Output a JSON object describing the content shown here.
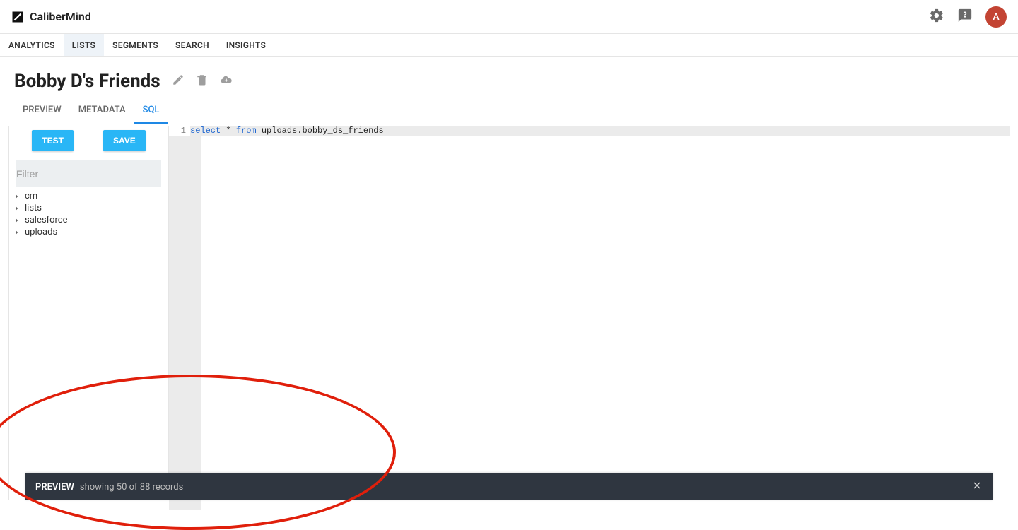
{
  "brand": {
    "name": "CaliberMind"
  },
  "header_actions": {
    "avatar_initial": "A"
  },
  "nav": {
    "items": [
      {
        "label": "ANALYTICS"
      },
      {
        "label": "LISTS"
      },
      {
        "label": "SEGMENTS"
      },
      {
        "label": "SEARCH"
      },
      {
        "label": "INSIGHTS"
      }
    ],
    "active_index": 1
  },
  "page": {
    "title": "Bobby D's Friends"
  },
  "sub_tabs": {
    "items": [
      {
        "label": "PREVIEW"
      },
      {
        "label": "METADATA"
      },
      {
        "label": "SQL"
      }
    ],
    "active_index": 2
  },
  "buttons": {
    "test": "TEST",
    "save": "SAVE"
  },
  "filter": {
    "placeholder": "Filter"
  },
  "tree": {
    "items": [
      {
        "label": "cm"
      },
      {
        "label": "lists"
      },
      {
        "label": "salesforce"
      },
      {
        "label": "uploads"
      }
    ]
  },
  "editor": {
    "line_number": "1",
    "sql_kw1": "select",
    "sql_star": " * ",
    "sql_kw2": "from",
    "sql_rest": " uploads.bobby_ds_friends"
  },
  "toast": {
    "title": "PREVIEW",
    "subtitle": "showing 50 of 88 records"
  }
}
